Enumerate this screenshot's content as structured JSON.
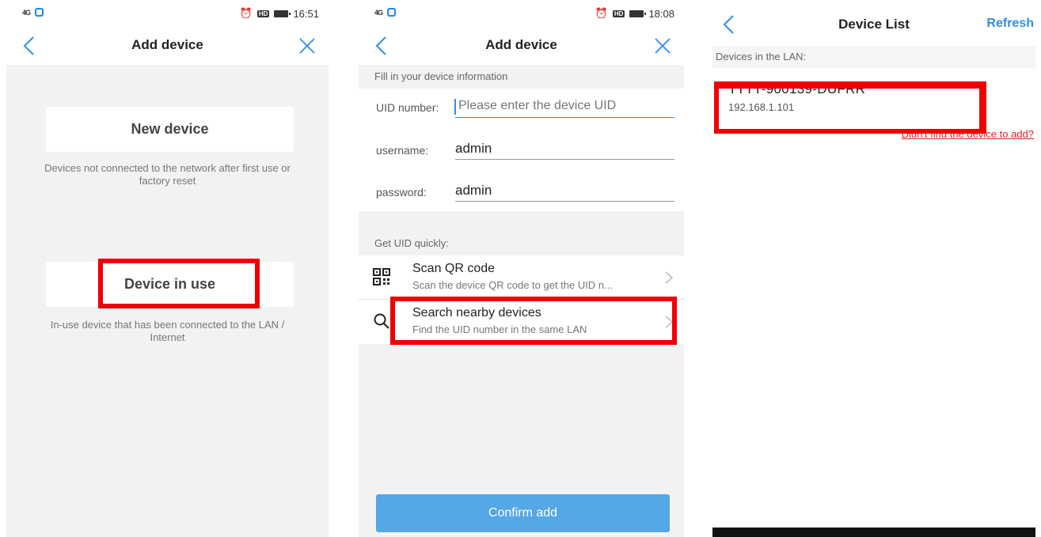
{
  "screens": [
    {
      "status": {
        "signal": "4G",
        "time": "16:51"
      },
      "title": "Add device",
      "new_device": {
        "label": "New device",
        "description": "Devices not connected to the network after first use or factory reset"
      },
      "device_in_use": {
        "label": "Device in use",
        "description": "In-use device that has been connected to the LAN / Internet"
      }
    },
    {
      "status": {
        "signal": "4G",
        "time": "18:08"
      },
      "title": "Add device",
      "section_label": "Fill in your device information",
      "fields": {
        "uid": {
          "label": "UID number:",
          "placeholder": "Please enter the device UID"
        },
        "username": {
          "label": "username:",
          "value": "admin"
        },
        "password": {
          "label": "password:",
          "value": "admin"
        }
      },
      "quick_label": "Get UID quickly:",
      "options": [
        {
          "title": "Scan QR code",
          "subtitle": "Scan the device QR code to get the UID n..."
        },
        {
          "title": "Search nearby devices",
          "subtitle": "Find the UID number in the same LAN"
        }
      ],
      "confirm_label": "Confirm add"
    },
    {
      "title": "Device List",
      "refresh_label": "Refresh",
      "lan_label": "Devices in the LAN:",
      "device": {
        "name": "TTTT-900139-DUFRR",
        "ip": "192.168.1.101"
      },
      "not_found_link": "Didn't find the device to add?"
    }
  ],
  "colors": {
    "accent": "#2d8fe8",
    "highlight": "#ee0000",
    "confirm_button": "#55a7e6"
  },
  "icons": [
    "back-icon",
    "close-icon",
    "qr-code-icon",
    "search-icon",
    "chevron-right-icon"
  ]
}
